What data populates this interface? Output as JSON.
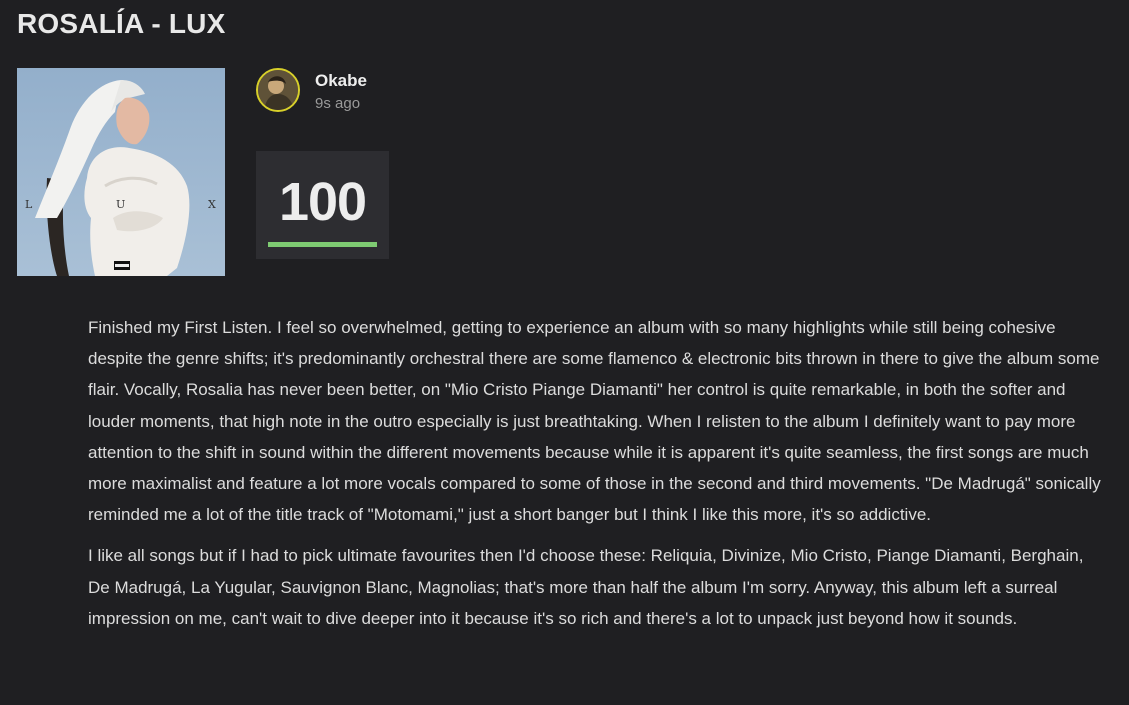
{
  "review": {
    "title": "ROSALÍA - LUX",
    "cover": {
      "letters": [
        "L",
        "U",
        "X"
      ]
    },
    "author": {
      "name": "Okabe",
      "time_ago": "9s ago"
    },
    "score": {
      "value": "100",
      "fraction": 1.0,
      "bar_color": "#7ecb72"
    },
    "paragraphs": [
      "Finished my First Listen. I feel so overwhelmed, getting to experience an album with so many highlights while still being cohesive despite the genre shifts; it's predominantly orchestral there are some flamenco & electronic bits thrown in there to give the album some flair. Vocally, Rosalia has never been better, on \"Mio Cristo Piange Diamanti\" her control is quite remarkable, in both the softer and louder moments, that high note in the outro especially is just breathtaking. When I relisten to the album I definitely want to pay more attention to the shift in sound within the different movements because while it is apparent it's quite seamless, the first songs are much more maximalist and feature a lot more vocals compared to some of those in the second and third movements. \"De Madrugá\" sonically reminded me a lot of the title track of \"Motomami,\" just a short banger but I think I like this more, it's so addictive.",
      "I like all songs but if I had to pick ultimate favourites then I'd choose these: Reliquia, Divinize, Mio Cristo, Piange Diamanti, Berghain, De Madrugá, La Yugular, Sauvignon Blanc, Magnolias; that's more than half the album I'm sorry. Anyway, this album left a surreal impression on me, can't wait to dive deeper into it because it's so rich and there's a lot to unpack just beyond how it sounds."
    ]
  },
  "colors": {
    "background": "#1f1f22",
    "score_box": "#2d2d31",
    "avatar_ring": "#d8d02a",
    "text": "#dcdcdc",
    "muted": "#9a9a9a"
  },
  "icons": {
    "cover": "album-cover-image",
    "avatar": "user-avatar-image"
  }
}
